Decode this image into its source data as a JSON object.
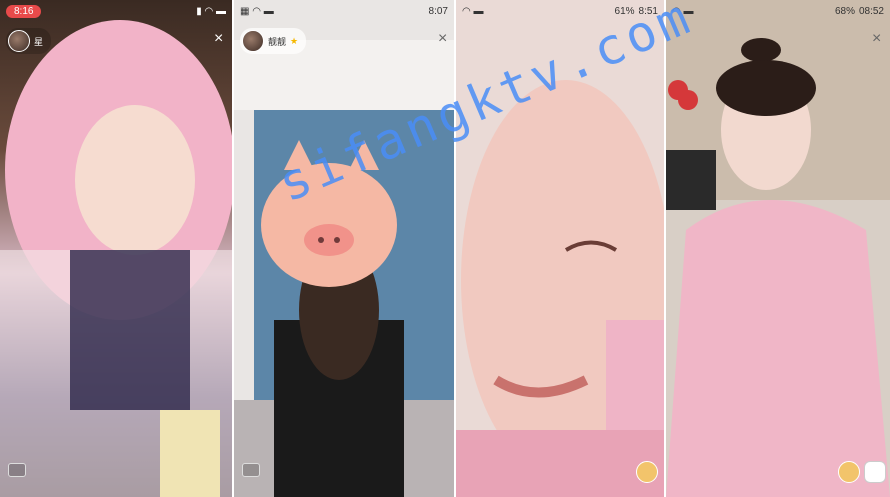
{
  "panels": [
    {
      "time": "8:16",
      "streamer_name": "星",
      "status_icons": "▮ ◠ ▬",
      "close_label": "×",
      "chat_label": ""
    },
    {
      "time": "8:07",
      "streamer_name": "靓靓",
      "status_icons": "▦ ◠ ▬",
      "close_label": "×",
      "chat_label": ""
    },
    {
      "time": "8:51",
      "battery": "61%",
      "status_icons": "◠ ▬",
      "close_label": "",
      "chat_label": ""
    },
    {
      "time": "08:52",
      "battery": "68%",
      "status_icons": "◠ ▬",
      "close_label": "×",
      "chat_label": ""
    }
  ],
  "watermark": "sifangktv.com"
}
